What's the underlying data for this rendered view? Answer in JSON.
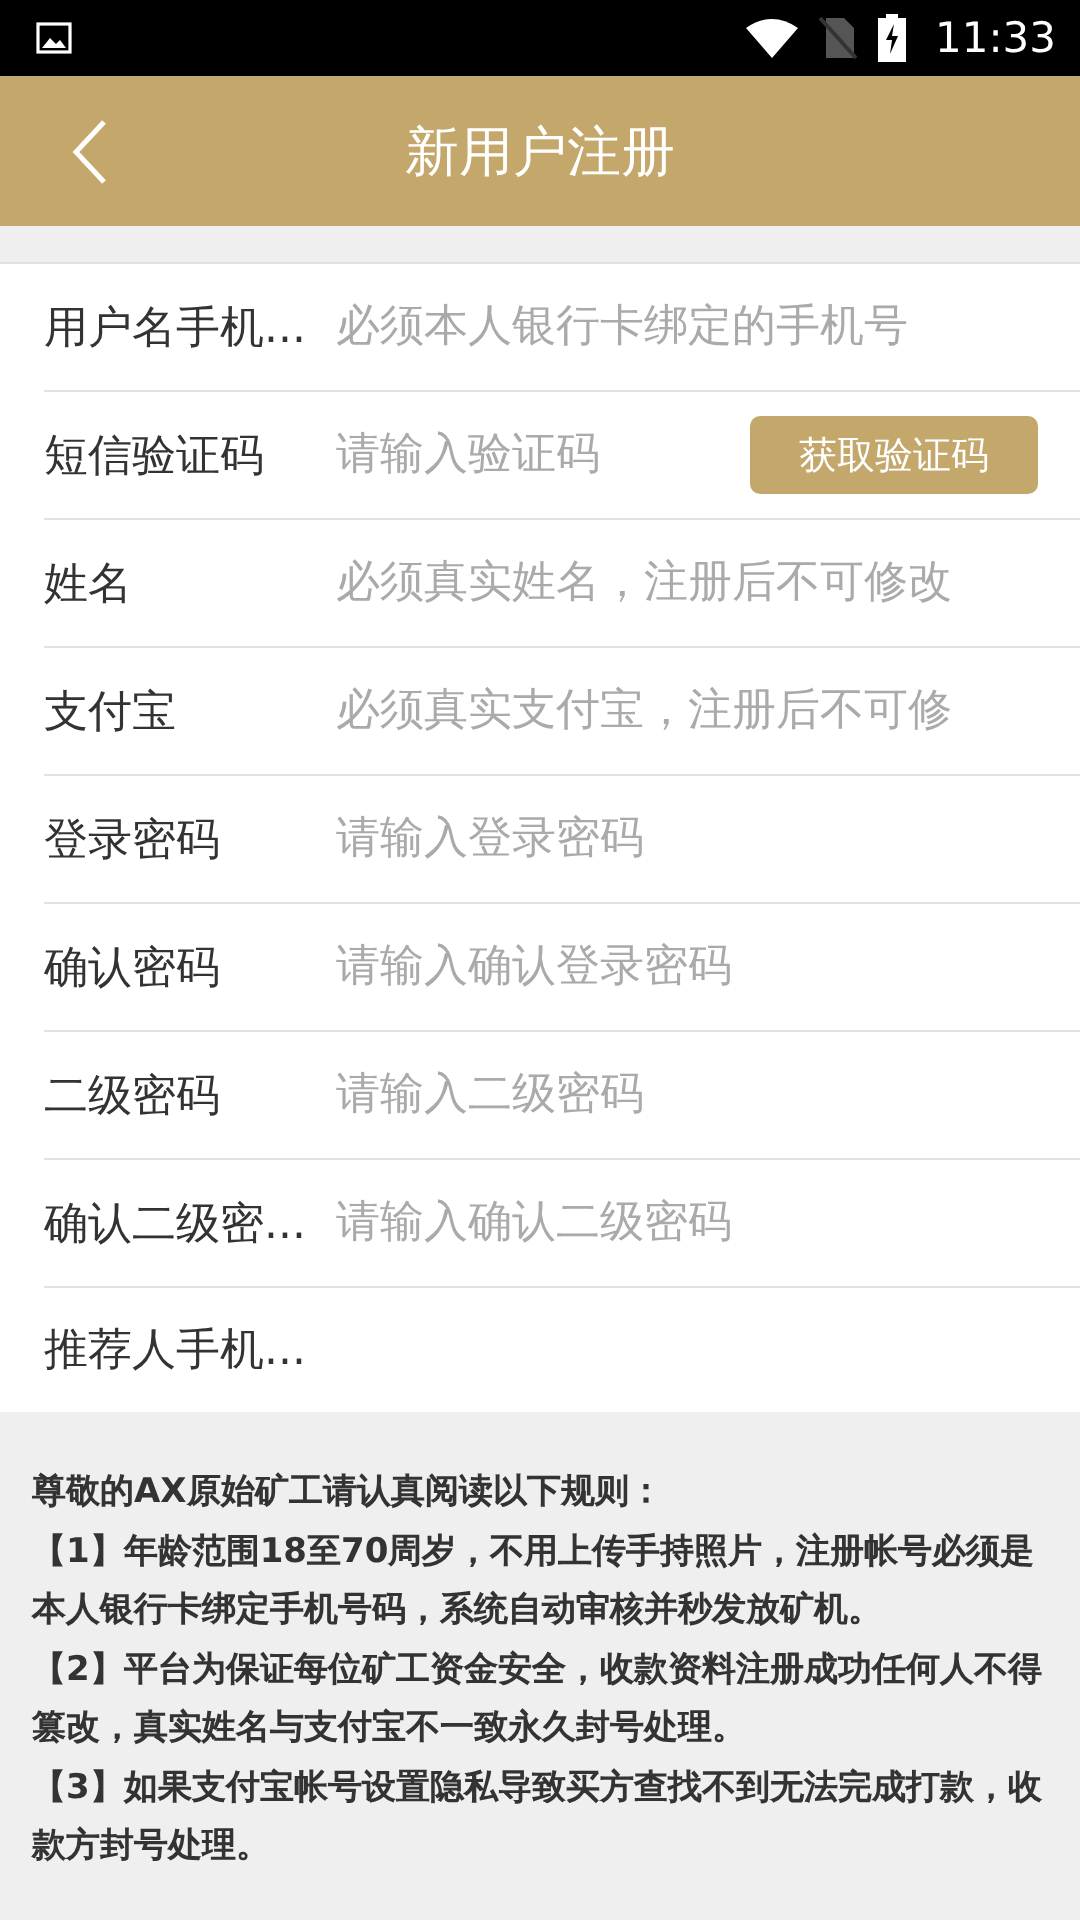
{
  "status_bar": {
    "time": "11:33"
  },
  "header": {
    "title": "新用户注册"
  },
  "fields": [
    {
      "label": "用户名手机...",
      "placeholder": "必须本人银行卡绑定的手机号"
    },
    {
      "label": "短信验证码",
      "placeholder": "请输入验证码",
      "button": "获取验证码"
    },
    {
      "label": "姓名",
      "placeholder": "必须真实姓名，注册后不可修改"
    },
    {
      "label": "支付宝",
      "placeholder": "必须真实支付宝，注册后不可修"
    },
    {
      "label": "登录密码",
      "placeholder": "请输入登录密码"
    },
    {
      "label": "确认密码",
      "placeholder": "请输入确认登录密码"
    },
    {
      "label": "二级密码",
      "placeholder": "请输入二级密码"
    },
    {
      "label": "确认二级密...",
      "placeholder": "请输入确认二级密码"
    },
    {
      "label": "推荐人手机..."
    }
  ],
  "rules": {
    "heading": "尊敬的AX原始矿工请认真阅读以下规则：",
    "items": [
      "【1】年龄范围18至70周岁，不用上传手持照片，注册帐号必须是本人银行卡绑定手机号码，系统自动审核并秒发放矿机。",
      "【2】平台为保证每位矿工资金安全，收款资料注册成功任何人不得篡改，真实姓名与支付宝不一致永久封号处理。",
      "【3】如果支付宝帐号设置隐私导致买方查找不到无法完成打款，收款方封号处理。"
    ]
  }
}
